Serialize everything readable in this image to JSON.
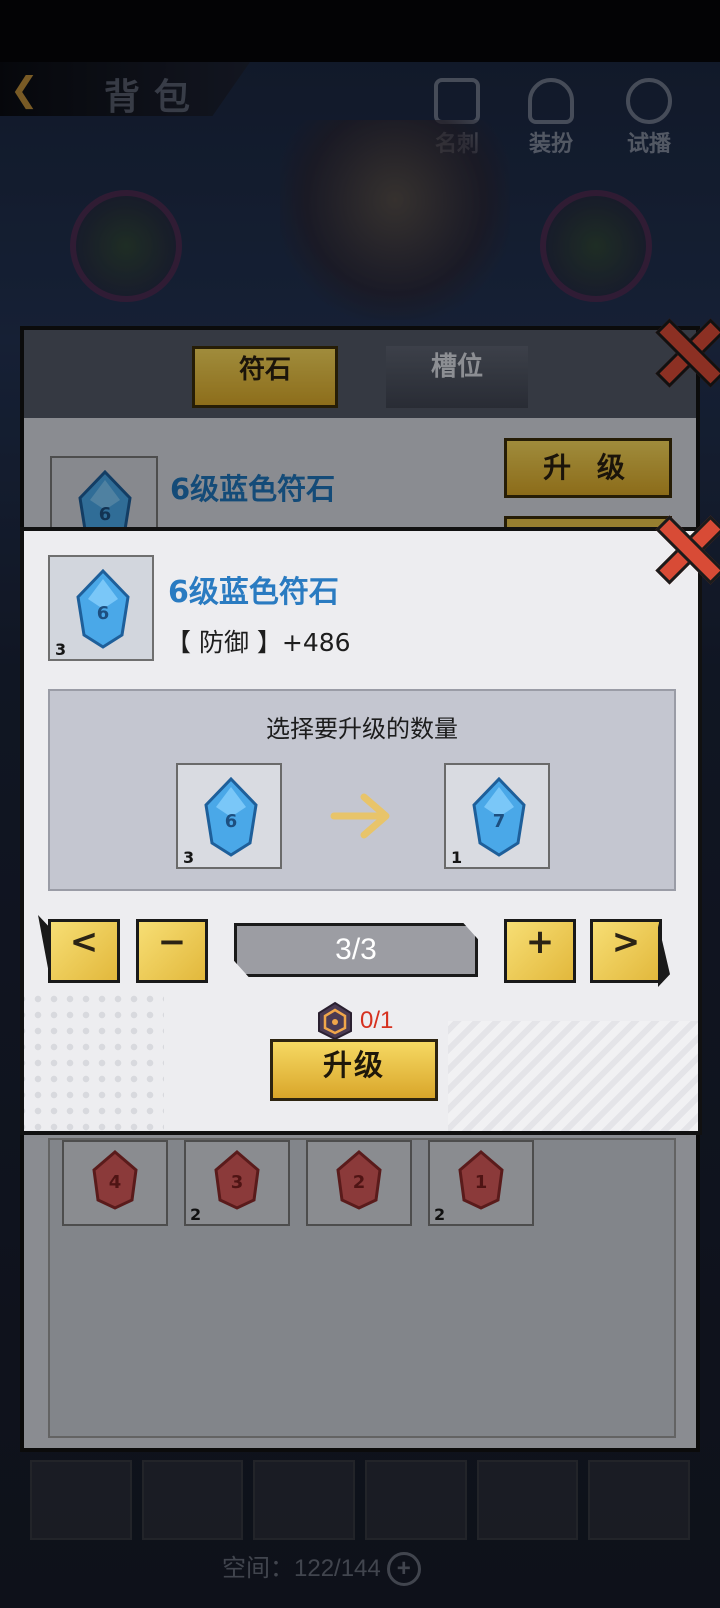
{
  "header": {
    "back_icon": "chevron-left-icon",
    "title": "背包"
  },
  "top_icons": [
    {
      "label": "名刺",
      "icon": "card-icon"
    },
    {
      "label": "装扮",
      "icon": "outfit-icon"
    },
    {
      "label": "试播",
      "icon": "magnifier-icon"
    }
  ],
  "rune_panel": {
    "tabs": [
      {
        "label": "符石",
        "active": true
      },
      {
        "label": "槽位",
        "active": false
      }
    ],
    "item_name": "6级蓝色符石",
    "item_level": "6",
    "upgrade_label": "升 级",
    "red_runes": [
      {
        "level": "4",
        "count": ""
      },
      {
        "level": "3",
        "count": "2"
      },
      {
        "level": "2",
        "count": ""
      },
      {
        "level": "1",
        "count": "2"
      }
    ]
  },
  "dialog": {
    "item_name": "6级蓝色符石",
    "item_level": "6",
    "item_count": "3",
    "stat": "【 防御 】+486",
    "select_title": "选择要升级的数量",
    "from": {
      "level": "6",
      "count": "3"
    },
    "to": {
      "level": "7",
      "count": "1"
    },
    "quantity": "3/3",
    "prev_label": "<",
    "minus_label": "−",
    "plus_label": "+",
    "next_label": ">",
    "cost": "0/1",
    "cost_icon": "rune-material-icon",
    "upgrade_label": "升级"
  },
  "footer": {
    "space_label": "空间：122/144"
  },
  "colors": {
    "gold": "#e6b83a",
    "blue_text": "#2a7bc1",
    "red_cost": "#d6311f",
    "close_red": "#d84b36"
  }
}
